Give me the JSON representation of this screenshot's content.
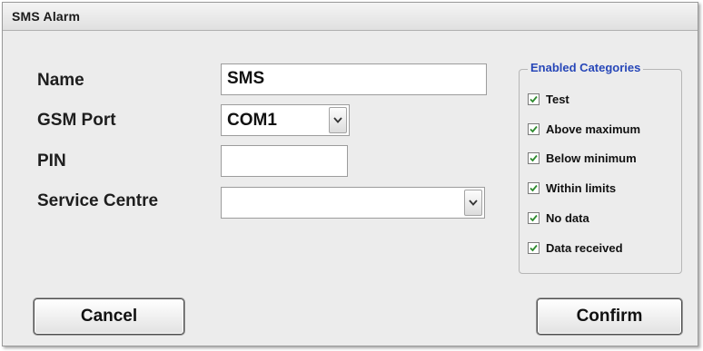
{
  "window": {
    "title": "SMS Alarm"
  },
  "form": {
    "name": {
      "label": "Name",
      "value": "SMS"
    },
    "gsm_port": {
      "label": "GSM Port",
      "value": "COM1"
    },
    "pin": {
      "label": "PIN",
      "value": ""
    },
    "service_centre": {
      "label": "Service Centre",
      "value": ""
    }
  },
  "categories": {
    "legend": "Enabled Categories",
    "items": [
      {
        "label": "Test",
        "checked": true
      },
      {
        "label": "Above maximum",
        "checked": true
      },
      {
        "label": "Below minimum",
        "checked": true
      },
      {
        "label": "Within limits",
        "checked": true
      },
      {
        "label": "No data",
        "checked": true
      },
      {
        "label": "Data received",
        "checked": true
      }
    ]
  },
  "buttons": {
    "cancel": "Cancel",
    "confirm": "Confirm"
  },
  "colors": {
    "legend": "#2747b8",
    "check": "#2e8b2e",
    "background": "#ececec"
  }
}
